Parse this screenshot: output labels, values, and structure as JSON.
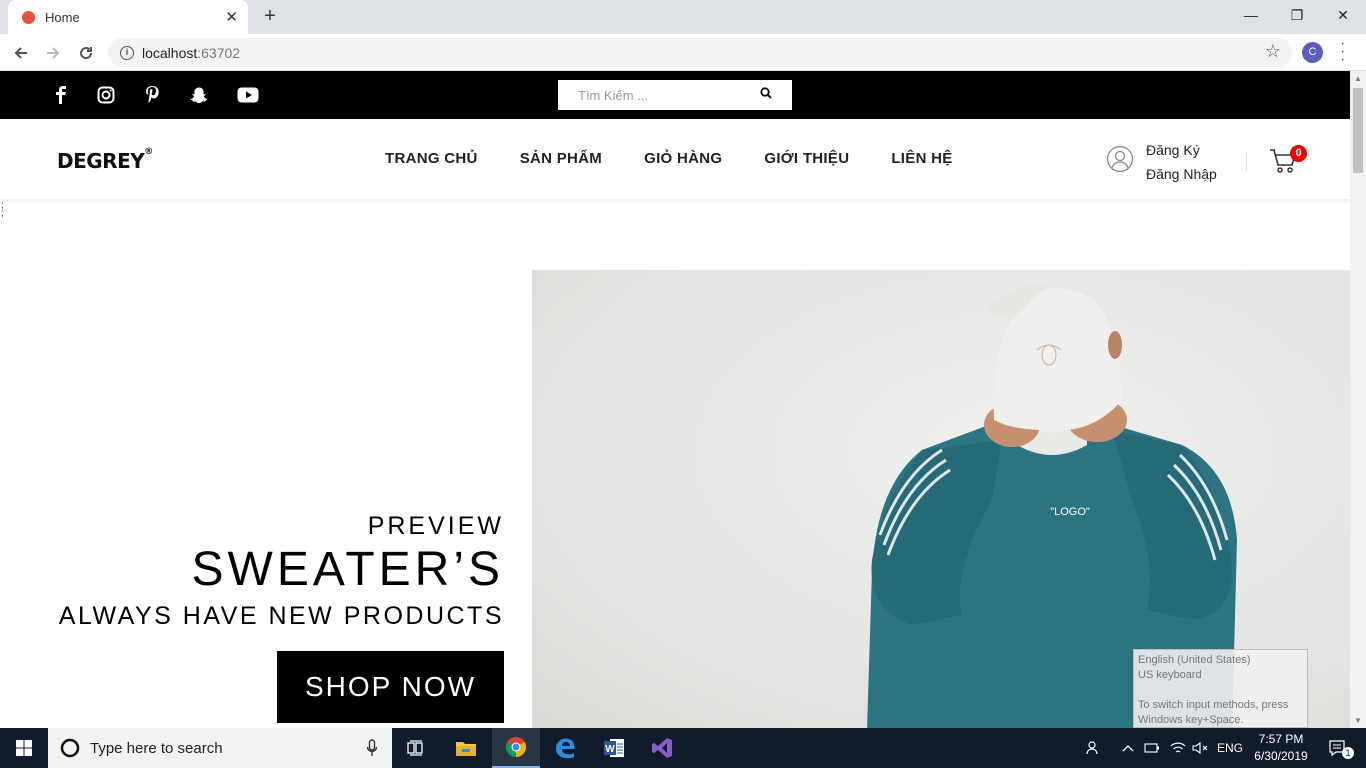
{
  "browser": {
    "tab_title": "Home",
    "tab_close": "✕",
    "new_tab": "+",
    "url_host": "localhost",
    "url_port": ":63702",
    "profile_initial": "C",
    "window_controls": {
      "minimize": "—",
      "restore": "❐",
      "close": "✕"
    }
  },
  "site": {
    "social_icons": [
      "facebook-icon",
      "instagram-icon",
      "pinterest-icon",
      "snapchat-icon",
      "youtube-icon"
    ],
    "search": {
      "placeholder": "Tìm Kiếm ..."
    },
    "logo": "DEGREY",
    "logo_mark": "®",
    "menu": [
      "TRANG CHỦ",
      "SẢN PHẨM",
      "GIỎ HÀNG",
      "GIỚI THIỆU",
      "LIÊN HỆ"
    ],
    "auth": {
      "register": "Đăng Ký",
      "login": "Đăng Nhập"
    },
    "cart_count": "0",
    "stray_text": ";\n;"
  },
  "hero": {
    "preview": "PREVIEW",
    "title": "SWEATER’S",
    "subtitle": "ALWAYS HAVE NEW PRODUCTS",
    "button": "SHOP NOW",
    "shirt_print": "\"LOGO\""
  },
  "ime_popup": {
    "line1": "English (United States)",
    "line2": "US keyboard",
    "line3": "To switch input methods, press",
    "line4": "Windows key+Space."
  },
  "taskbar": {
    "search_placeholder": "Type here to search",
    "language": "ENG",
    "time": "7:57 PM",
    "date": "6/30/2019",
    "notifications": "1"
  }
}
